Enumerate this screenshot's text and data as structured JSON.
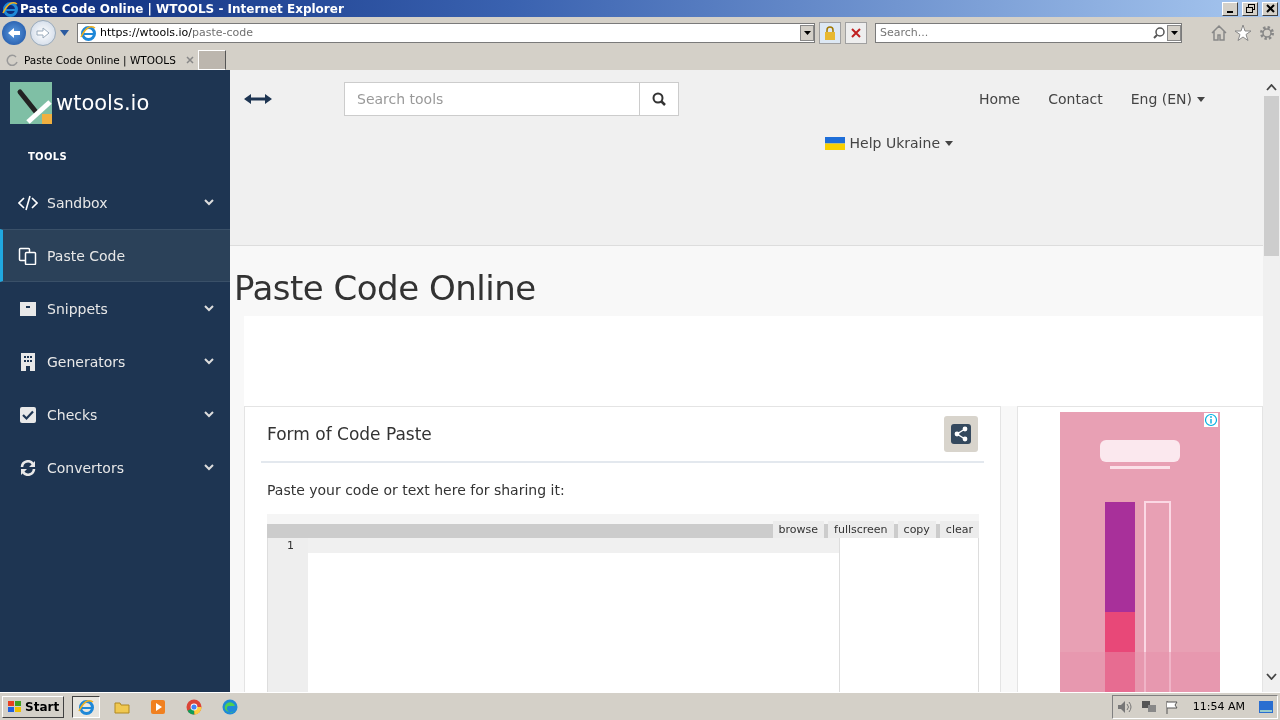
{
  "window": {
    "title": "Paste Code Online | WTOOLS - Internet Explorer"
  },
  "address_bar": {
    "url_host": "https://wtools.io/",
    "url_path": "paste-code",
    "search_placeholder": "Search..."
  },
  "tabs": [
    {
      "label": "Paste Code Online | WTOOLS",
      "selected": true
    }
  ],
  "sidebar": {
    "logo": "wtools.io",
    "section": "TOOLS",
    "items": [
      {
        "label": "Sandbox",
        "kind": "code",
        "selected": false,
        "expandable": true
      },
      {
        "label": "Paste Code",
        "kind": "paste",
        "selected": true,
        "expandable": false
      },
      {
        "label": "Snippets",
        "kind": "box",
        "selected": false,
        "expandable": true
      },
      {
        "label": "Generators",
        "kind": "building",
        "selected": false,
        "expandable": true
      },
      {
        "label": "Checks",
        "kind": "check",
        "selected": false,
        "expandable": true
      },
      {
        "label": "Convertors",
        "kind": "refresh",
        "selected": false,
        "expandable": true
      }
    ]
  },
  "topbar": {
    "search_placeholder": "Search tools",
    "nav": [
      "Home",
      "Contact"
    ],
    "language": "Eng (EN)",
    "help": "Help Ukraine"
  },
  "page_title": "Paste Code Online",
  "form": {
    "title": "Form of Code Paste",
    "prompt": "Paste your code or text here for sharing it:",
    "editor_buttons": [
      "browse",
      "fullscreen",
      "copy",
      "clear"
    ],
    "line_numbers": [
      "1"
    ]
  },
  "taskbar": {
    "start": "Start",
    "clock": "11:54 AM"
  }
}
